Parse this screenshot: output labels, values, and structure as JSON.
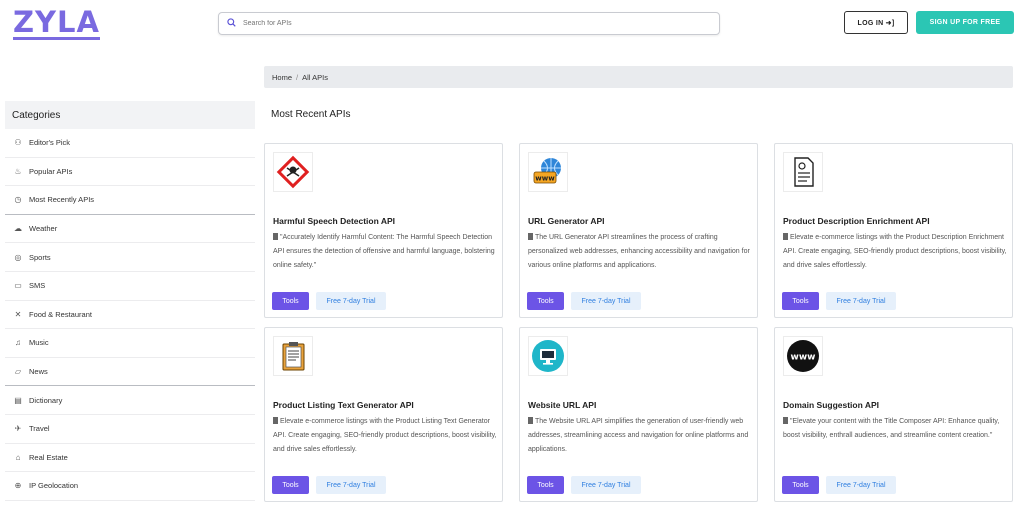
{
  "header": {
    "logo": "ZYLA",
    "search_placeholder": "Search for APIs",
    "login_label": "LOG IN ➜]",
    "signup_label": "SIGN UP FOR FREE"
  },
  "breadcrumb": {
    "home": "Home",
    "sep": "/",
    "current": "All APIs"
  },
  "sidebar": {
    "title": "Categories",
    "items": [
      {
        "label": "Editor's Pick",
        "icon": "people-icon"
      },
      {
        "label": "Popular APIs",
        "icon": "flame-icon"
      },
      {
        "label": "Most Recently APIs",
        "icon": "clock-icon"
      },
      {
        "label": "Weather",
        "icon": "cloud-icon"
      },
      {
        "label": "Sports",
        "icon": "ball-icon"
      },
      {
        "label": "SMS",
        "icon": "message-icon"
      },
      {
        "label": "Food & Restaurant",
        "icon": "utensils-icon"
      },
      {
        "label": "Music",
        "icon": "music-icon"
      },
      {
        "label": "News",
        "icon": "folder-icon"
      },
      {
        "label": "Dictionary",
        "icon": "book-icon"
      },
      {
        "label": "Travel",
        "icon": "plane-icon"
      },
      {
        "label": "Real Estate",
        "icon": "home-icon"
      },
      {
        "label": "IP Geolocation",
        "icon": "location-icon"
      }
    ]
  },
  "section_title": "Most Recent APIs",
  "cards": [
    {
      "name": "Harmful Speech Detection API",
      "desc": "\"Accurately Identify Harmful Content: The Harmful Speech Detection API ensures the detection of offensive and harmful language, bolstering online safety.\"",
      "tag1": "Tools",
      "tag2": "Free 7-day Trial",
      "icon": "hazard-icon"
    },
    {
      "name": "URL Generator API",
      "desc": "The URL Generator API streamlines the process of crafting personalized web addresses, enhancing accessibility and navigation for various online platforms and applications.",
      "tag1": "Tools",
      "tag2": "Free 7-day Trial",
      "icon": "www-globe-icon"
    },
    {
      "name": "Product Description Enrichment API",
      "desc": "Elevate e-commerce listings with the Product Description Enrichment API. Create engaging, SEO-friendly product descriptions, boost visibility, and drive sales effortlessly.",
      "tag1": "Tools",
      "tag2": "Free 7-day Trial",
      "icon": "document-icon"
    },
    {
      "name": "Product Listing Text Generator API",
      "desc": "Elevate e-commerce listings with the Product Listing Text Generator API. Create engaging, SEO-friendly product descriptions, boost visibility, and drive sales effortlessly.",
      "tag1": "Tools",
      "tag2": "Free 7-day Trial",
      "icon": "clipboard-icon"
    },
    {
      "name": "Website URL API",
      "desc": "The Website URL API simplifies the generation of user-friendly web addresses, streamlining access and navigation for online platforms and applications.",
      "tag1": "Tools",
      "tag2": "Free 7-day Trial",
      "icon": "monitor-icon"
    },
    {
      "name": "Domain Suggestion API",
      "desc": "\"Elevate your content with the Title Composer API: Enhance quality, boost visibility, enthrall audiences, and streamline content creation.\"",
      "tag1": "Tools",
      "tag2": "Free 7-day Trial",
      "icon": "www-circle-icon"
    }
  ]
}
